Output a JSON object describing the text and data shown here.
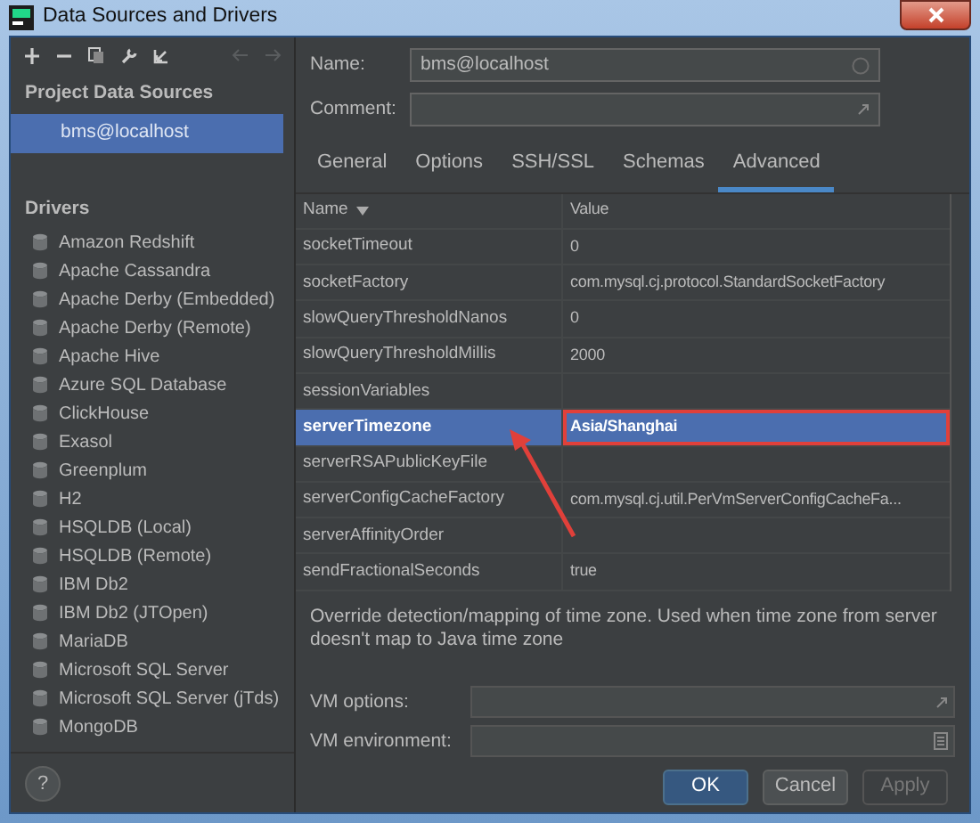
{
  "window": {
    "title": "Data Sources and Drivers"
  },
  "sidebar": {
    "project_heading": "Project Data Sources",
    "project_items": [
      {
        "label": "bms@localhost",
        "selected": true
      }
    ],
    "drivers_heading": "Drivers",
    "drivers": [
      {
        "label": "Amazon Redshift"
      },
      {
        "label": "Apache Cassandra"
      },
      {
        "label": "Apache Derby (Embedded)"
      },
      {
        "label": "Apache Derby (Remote)"
      },
      {
        "label": "Apache Hive"
      },
      {
        "label": "Azure SQL Database"
      },
      {
        "label": "ClickHouse"
      },
      {
        "label": "Exasol"
      },
      {
        "label": "Greenplum"
      },
      {
        "label": "H2"
      },
      {
        "label": "HSQLDB (Local)"
      },
      {
        "label": "HSQLDB (Remote)"
      },
      {
        "label": "IBM Db2"
      },
      {
        "label": "IBM Db2 (JTOpen)"
      },
      {
        "label": "MariaDB"
      },
      {
        "label": "Microsoft SQL Server"
      },
      {
        "label": "Microsoft SQL Server (jTds)"
      },
      {
        "label": "MongoDB"
      }
    ],
    "help": "?"
  },
  "form": {
    "name_label": "Name:",
    "name_value": "bms@localhost",
    "comment_label": "Comment:"
  },
  "tabs": [
    {
      "label": "General",
      "selected": false
    },
    {
      "label": "Options",
      "selected": false
    },
    {
      "label": "SSH/SSL",
      "selected": false
    },
    {
      "label": "Schemas",
      "selected": false
    },
    {
      "label": "Advanced",
      "selected": true
    }
  ],
  "table": {
    "columns": [
      {
        "label": "Name",
        "sorted": true
      },
      {
        "label": "Value",
        "sorted": false
      }
    ],
    "rows": [
      {
        "name": "socketTimeout",
        "value": "0",
        "selected": false,
        "annotated": false
      },
      {
        "name": "socketFactory",
        "value": "com.mysql.cj.protocol.StandardSocketFactory",
        "selected": false,
        "annotated": false
      },
      {
        "name": "slowQueryThresholdNanos",
        "value": "0",
        "selected": false,
        "annotated": false
      },
      {
        "name": "slowQueryThresholdMillis",
        "value": "2000",
        "selected": false,
        "annotated": false
      },
      {
        "name": "sessionVariables",
        "value": "",
        "selected": false,
        "annotated": false
      },
      {
        "name": "serverTimezone",
        "value": "Asia/Shanghai",
        "selected": true,
        "annotated": true
      },
      {
        "name": "serverRSAPublicKeyFile",
        "value": "",
        "selected": false,
        "annotated": false
      },
      {
        "name": "serverConfigCacheFactory",
        "value": "com.mysql.cj.util.PerVmServerConfigCacheFa...",
        "selected": false,
        "annotated": false
      },
      {
        "name": "serverAffinityOrder",
        "value": "",
        "selected": false,
        "annotated": false
      },
      {
        "name": "sendFractionalSeconds",
        "value": "true",
        "selected": false,
        "annotated": false
      }
    ]
  },
  "description": "Override detection/mapping of time zone. Used when time zone from server doesn't map to Java time zone",
  "vm_fields": [
    {
      "label": "VM options:",
      "kind": "expand"
    },
    {
      "label": "VM environment:",
      "kind": "list"
    }
  ],
  "buttons": [
    {
      "label": "OK",
      "kind": "primary"
    },
    {
      "label": "Cancel",
      "kind": "normal"
    },
    {
      "label": "Apply",
      "kind": "disabled"
    }
  ]
}
